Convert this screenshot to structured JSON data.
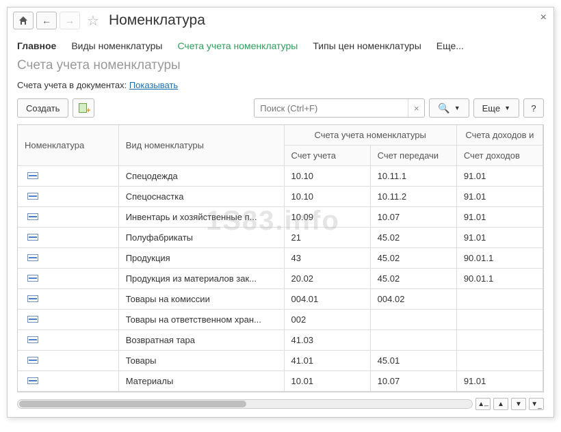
{
  "title": "Номенклатура",
  "tabs": {
    "main": "Главное",
    "kinds": "Виды номенклатуры",
    "accounts": "Счета учета номенклатуры",
    "price_types": "Типы цен номенклатуры",
    "more": "Еще..."
  },
  "subtitle": "Счета учета номенклатуры",
  "filter": {
    "label": "Счета учета в документах: ",
    "link": "Показывать"
  },
  "toolbar": {
    "create": "Создать",
    "search_placeholder": "Поиск (Ctrl+F)",
    "more": "Еще",
    "help": "?"
  },
  "columns": {
    "nomen": "Номенклатура",
    "kind": "Вид номенклатуры",
    "accounts_group": "Счета учета номенклатуры",
    "account": "Счет учета",
    "transfer": "Счет передачи",
    "income_group": "Счета доходов и",
    "income": "Счет доходов"
  },
  "rows": [
    {
      "kind": "Спецодежда",
      "acct": "10.10",
      "trans": "10.11.1",
      "inc": "91.01"
    },
    {
      "kind": "Спецоснастка",
      "acct": "10.10",
      "trans": "10.11.2",
      "inc": "91.01"
    },
    {
      "kind": "Инвентарь и хозяйственные п...",
      "acct": "10.09",
      "trans": "10.07",
      "inc": "91.01"
    },
    {
      "kind": "Полуфабрикаты",
      "acct": "21",
      "trans": "45.02",
      "inc": "91.01"
    },
    {
      "kind": "Продукция",
      "acct": "43",
      "trans": "45.02",
      "inc": "90.01.1"
    },
    {
      "kind": "Продукция из материалов зак...",
      "acct": "20.02",
      "trans": "45.02",
      "inc": "90.01.1"
    },
    {
      "kind": "Товары на комиссии",
      "acct": "004.01",
      "trans": "004.02",
      "inc": ""
    },
    {
      "kind": "Товары на ответственном хран...",
      "acct": "002",
      "trans": "",
      "inc": ""
    },
    {
      "kind": "Возвратная тара",
      "acct": "41.03",
      "trans": "",
      "inc": ""
    },
    {
      "kind": "Товары",
      "acct": "41.01",
      "trans": "45.01",
      "inc": ""
    },
    {
      "kind": "Материалы",
      "acct": "10.01",
      "trans": "10.07",
      "inc": "91.01"
    }
  ],
  "watermark": "1S83.info"
}
